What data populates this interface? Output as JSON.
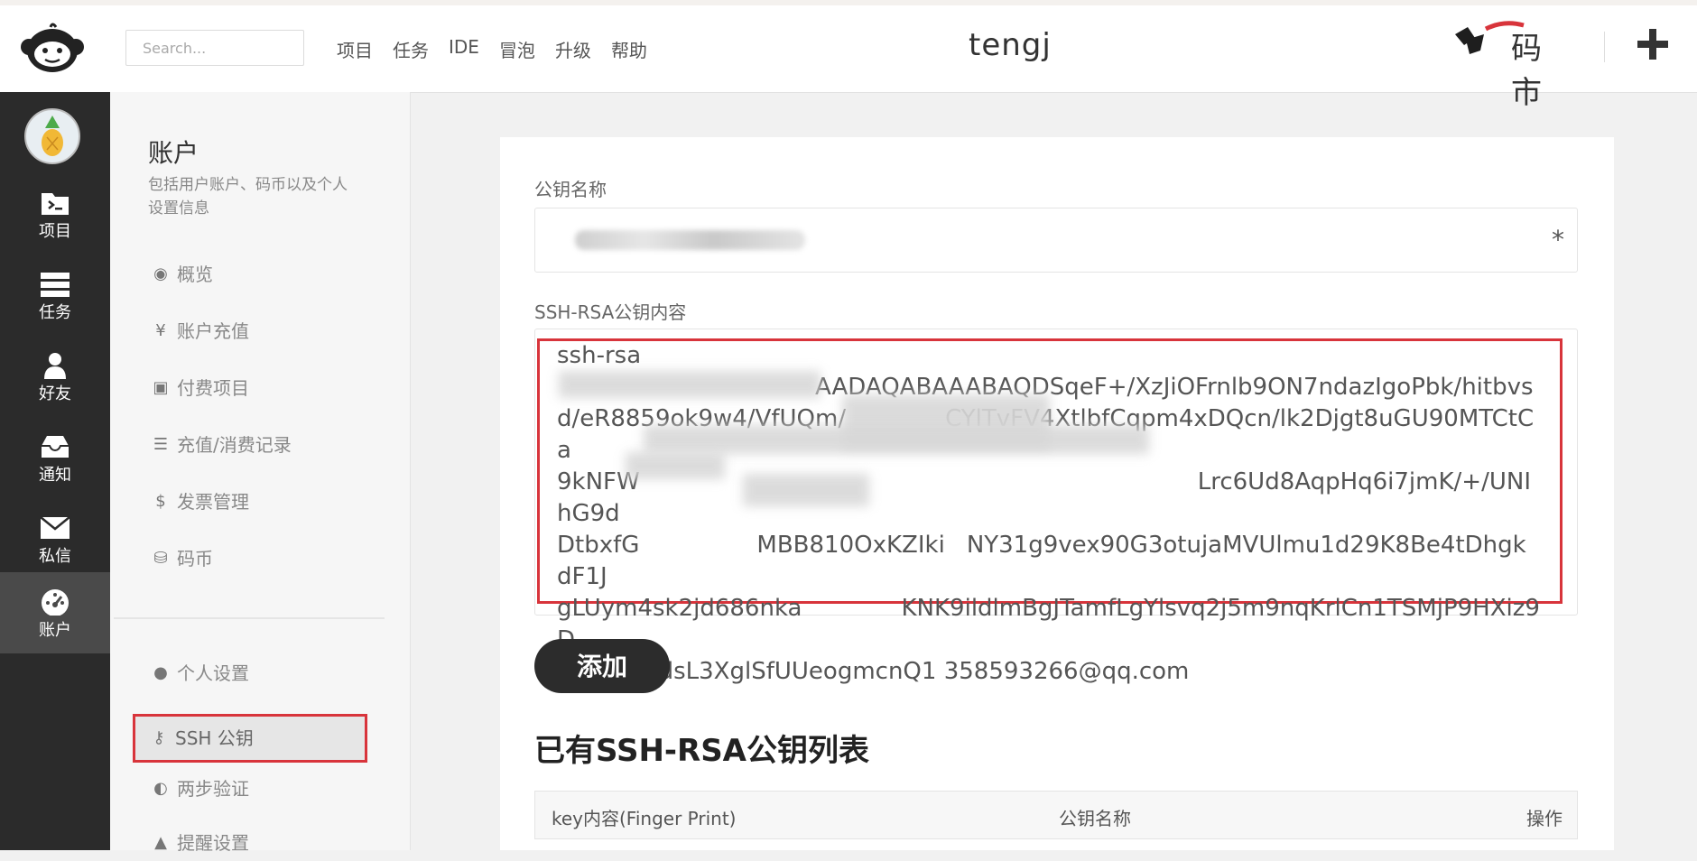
{
  "header": {
    "search_placeholder": "Search...",
    "nav": [
      "项目",
      "任务",
      "IDE",
      "冒泡",
      "升级",
      "帮助"
    ],
    "username": "tengj"
  },
  "darknav": [
    {
      "label": "项目",
      "icon": "project-icon"
    },
    {
      "label": "任务",
      "icon": "task-icon"
    },
    {
      "label": "好友",
      "icon": "friend-icon"
    },
    {
      "label": "通知",
      "icon": "notification-icon"
    },
    {
      "label": "私信",
      "icon": "message-icon"
    },
    {
      "label": "账户",
      "icon": "account-icon",
      "active": true
    }
  ],
  "account_menu": {
    "title": "账户",
    "description": "包括用户账户、码币以及个人设置信息",
    "items": [
      {
        "label": "概览",
        "icon": "dashboard-icon"
      },
      {
        "label": "账户充值",
        "icon": "yen-icon"
      },
      {
        "label": "付费项目",
        "icon": "paid-project-icon"
      },
      {
        "label": "充值/消费记录",
        "icon": "list-icon"
      },
      {
        "label": "发票管理",
        "icon": "dollar-icon"
      },
      {
        "label": "码币",
        "icon": "coin-icon"
      }
    ],
    "settings": [
      {
        "label": "个人设置",
        "icon": "user-icon"
      },
      {
        "label": "SSH 公钥",
        "icon": "key-icon",
        "active": true
      },
      {
        "label": "两步验证",
        "icon": "shield-icon"
      },
      {
        "label": "提醒设置",
        "icon": "bell-icon"
      }
    ]
  },
  "form": {
    "name_label": "公钥名称",
    "required_mark": "*",
    "content_label": "SSH-RSA公钥内容",
    "key_lines": [
      "ssh-rsa",
      "AADAQABAAABAQDSqeF+/XzJiOFrnlb9ON7ndazIgoPbk/hitbvs",
      "d/eR8859ok9w4/VfUQm/",
      "CYlTvFV4XtlbfCqpm4xDQcn/lk2Djgt8uGU90MTCtCa",
      "9kNFW",
      "Lrc6Ud8AqpHq6i7jmK/+/UNIhG9d",
      "DtbxfG",
      "MBB810OxKZIki",
      "NY31g9vex90G3otujaMVUlmu1d29K8Be4tDhgkdF1J",
      "gLUym4sk2jd686nka",
      "KNK9ildlmBgJTamfLgYlsvq2j5m9nqKrlCn1TSMjP9HXiz9D",
      "gL55rDZdsL3XglSfUUeogmcnQ1 358593266@qq.com"
    ],
    "submit_label": "添加"
  },
  "key_list": {
    "title": "已有SSH-RSA公钥列表",
    "columns": [
      "key内容(Finger Print)",
      "公钥名称",
      "操作"
    ]
  },
  "brand": {
    "coin_logo_text": "码 市"
  }
}
